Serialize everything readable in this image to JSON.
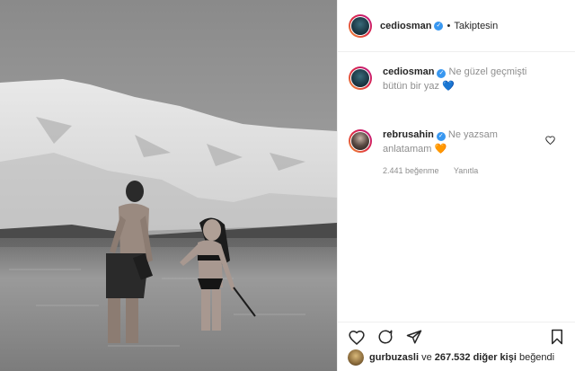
{
  "header": {
    "username": "cediosman",
    "separator": "•",
    "follow_label": "Takiptesin"
  },
  "caption": {
    "username": "cediosman",
    "text": "Ne güzel geçmişti bütün bir yaz",
    "emoji": "💙"
  },
  "comment": {
    "username": "rebrusahin",
    "text": "Ne yazsam anlatamam",
    "emoji": "🧡",
    "likes_label": "2.441 beğenme",
    "reply_label": "Yanıtla"
  },
  "likes": {
    "user": "gurbuzasli",
    "connector": "ve",
    "count_text": "267.532 diğer kişi",
    "suffix": "beğendi"
  },
  "icons": [
    "heart-icon",
    "comment-icon",
    "share-icon",
    "bookmark-icon",
    "verified-icon"
  ],
  "colors": {
    "verified": "#3897f0",
    "text": "#262626",
    "muted": "#8e8e8e"
  }
}
